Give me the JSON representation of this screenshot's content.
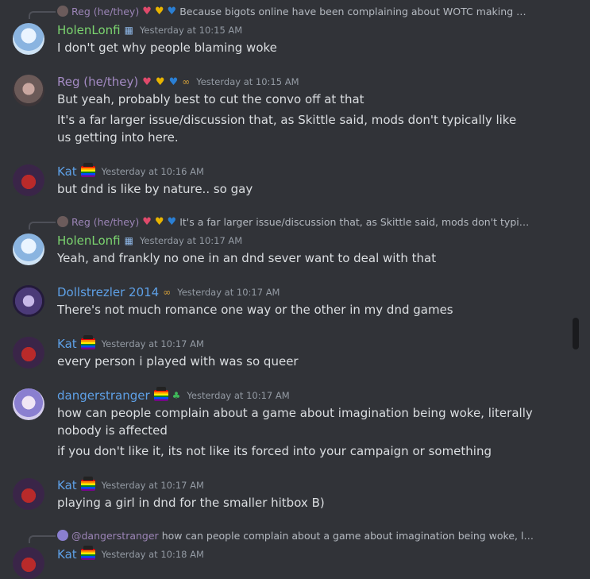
{
  "colors": {
    "background": "#313338",
    "text": "#dbdee1",
    "muted": "#949ba4",
    "holenlonfi": "#7bd46f",
    "reg": "#a48bc4",
    "blue": "#5ea0e6",
    "scrollbar": "#1a1b1e"
  },
  "messages": [
    {
      "reply": {
        "author": "Reg (he/they)",
        "text": "Because bigots online have been complaining about WOTC making D&..."
      },
      "author": "HolenLonfi",
      "time": "Yesterday at 10:15 AM",
      "lines": [
        "I don't get why people blaming woke"
      ]
    },
    {
      "author": "Reg (he/they)",
      "time": "Yesterday at 10:15 AM",
      "lines": [
        "But yeah, probably best to cut the convo off at that",
        "It's a far larger issue/discussion that, as Skittle said, mods don't typically like us getting into here."
      ]
    },
    {
      "author": "Kat",
      "time": "Yesterday at 10:16 AM",
      "lines": [
        "but dnd is like by nature.. so gay"
      ]
    },
    {
      "reply": {
        "author": "Reg (he/they)",
        "text": "It's a far larger issue/discussion that, as Skittle said, mods don't typical..."
      },
      "author": "HolenLonfi",
      "time": "Yesterday at 10:17 AM",
      "lines": [
        "Yeah, and frankly no one in an dnd sever want to deal with that"
      ]
    },
    {
      "author": "Dollstrezler 2014",
      "time": "Yesterday at 10:17 AM",
      "lines": [
        "There's not much romance one way or the other in my dnd games"
      ]
    },
    {
      "author": "Kat",
      "time": "Yesterday at 10:17 AM",
      "lines": [
        "every person i played with was so queer"
      ]
    },
    {
      "author": "dangerstranger",
      "time": "Yesterday at 10:17 AM",
      "lines": [
        "how can people complain about a game about imagination being woke, literally nobody is affected",
        "if you don't like it, its not like its forced into your campaign or something"
      ]
    },
    {
      "author": "Kat",
      "time": "Yesterday at 10:17 AM",
      "lines": [
        "playing a girl in dnd for the smaller hitbox B)"
      ]
    },
    {
      "reply": {
        "author": "@dangerstranger",
        "text": "how can people complain about a game about imagination being woke, literal..."
      },
      "author": "Kat",
      "time": "Yesterday at 10:18 AM",
      "lines": []
    }
  ]
}
